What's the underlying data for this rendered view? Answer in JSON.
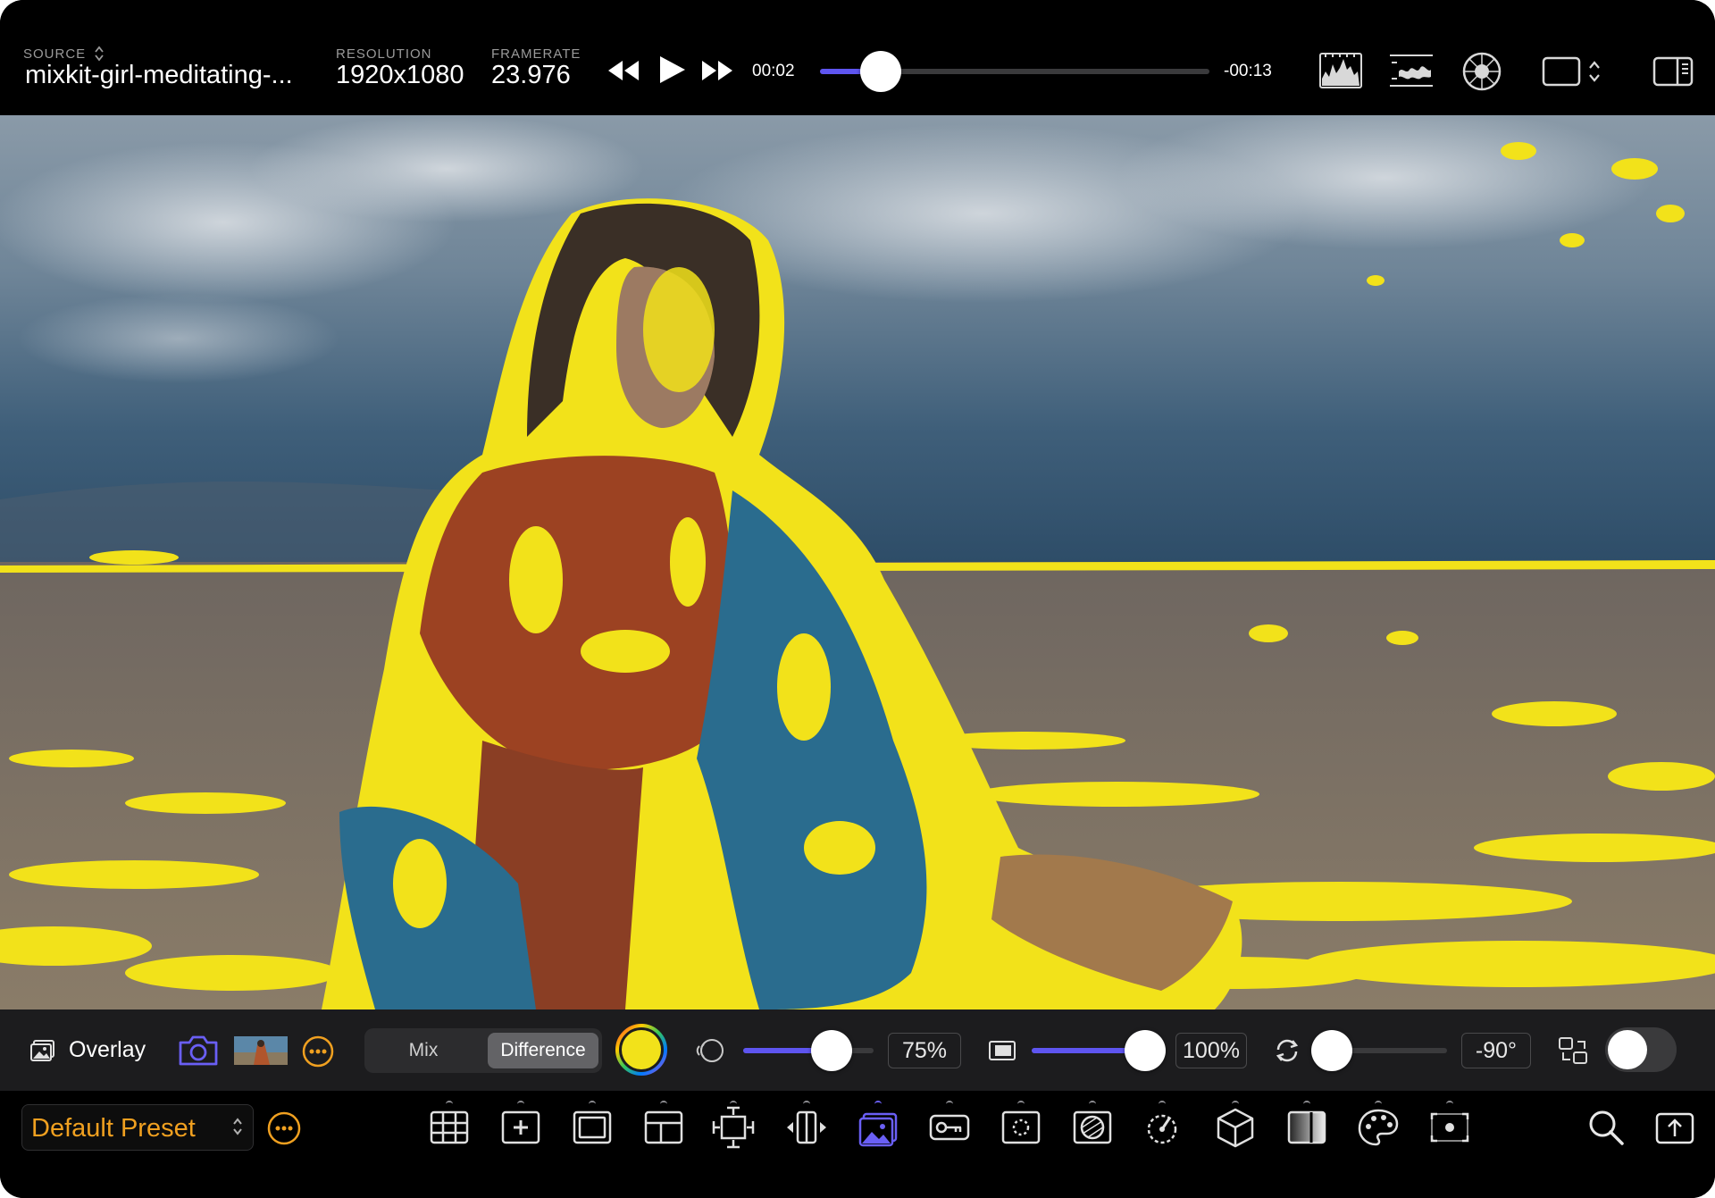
{
  "topbar": {
    "source_label": "SOURCE",
    "source_value": "mixkit-girl-meditating-...",
    "resolution_label": "RESOLUTION",
    "resolution_value": "1920x1080",
    "framerate_label": "FRAMERATE",
    "framerate_value": "23.976",
    "current_time": "00:02",
    "remaining_time": "-00:13",
    "playback_progress": 0.16,
    "icons": [
      "rewind-icon",
      "play-icon",
      "fast-forward-icon",
      "histogram-icon",
      "waveform-icon",
      "vectorscope-icon",
      "aspect-ratio-icon",
      "sidebar-toggle-icon"
    ]
  },
  "overlay_bar": {
    "overlay_label": "Overlay",
    "blend_modes": [
      "Mix",
      "Difference"
    ],
    "selected_blend_mode": "Difference",
    "overlay_color": "#f2e21a",
    "opacity_value": "75%",
    "opacity_level": 0.75,
    "scale_value": "100%",
    "scale_level": 1.0,
    "rotation_value": "-90°",
    "rotation_level": 0.0,
    "toggle_on": false
  },
  "bottombar": {
    "preset_label": "Default Preset",
    "tools": [
      "grid-icon",
      "crosshair-icon",
      "frame-guide-icon",
      "layout-icon",
      "transform-icon",
      "split-compare-icon",
      "image-overlay-icon",
      "key-icon",
      "safe-area-icon",
      "false-color-icon",
      "zebra-icon",
      "lut-cube-icon",
      "gradient-icon",
      "palette-icon",
      "focus-peaking-icon"
    ],
    "active_tool": "image-overlay-icon"
  },
  "colors": {
    "accent": "#5e55f0",
    "preset": "#f0a020",
    "overlay_yellow": "#f2e21a"
  }
}
